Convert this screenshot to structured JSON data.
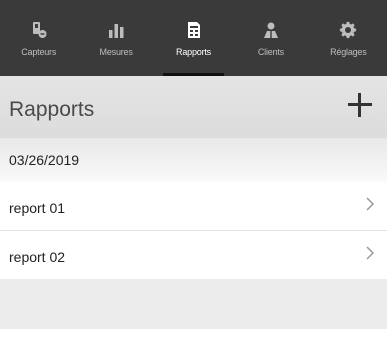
{
  "tabs": [
    {
      "id": "capteurs",
      "label": "Capteurs",
      "icon": "sensor-icon",
      "active": false
    },
    {
      "id": "mesures",
      "label": "Mesures",
      "icon": "bar-chart-icon",
      "active": false
    },
    {
      "id": "rapports",
      "label": "Rapports",
      "icon": "report-icon",
      "active": true
    },
    {
      "id": "clients",
      "label": "Clients",
      "icon": "users-icon",
      "active": false
    },
    {
      "id": "reglages",
      "label": "Réglages",
      "icon": "gear-icon",
      "active": false
    }
  ],
  "header": {
    "title": "Rapports",
    "add_icon": "plus-icon"
  },
  "section": {
    "date": "03/26/2019"
  },
  "reports": [
    {
      "label": "report 01"
    },
    {
      "label": "report 02"
    }
  ],
  "colors": {
    "tabbar_bg": "#3a3a3a",
    "tab_inactive": "#bdbdbd",
    "tab_active": "#ffffff",
    "indicator": "#111111",
    "header_bg": "#e0e0e0"
  }
}
